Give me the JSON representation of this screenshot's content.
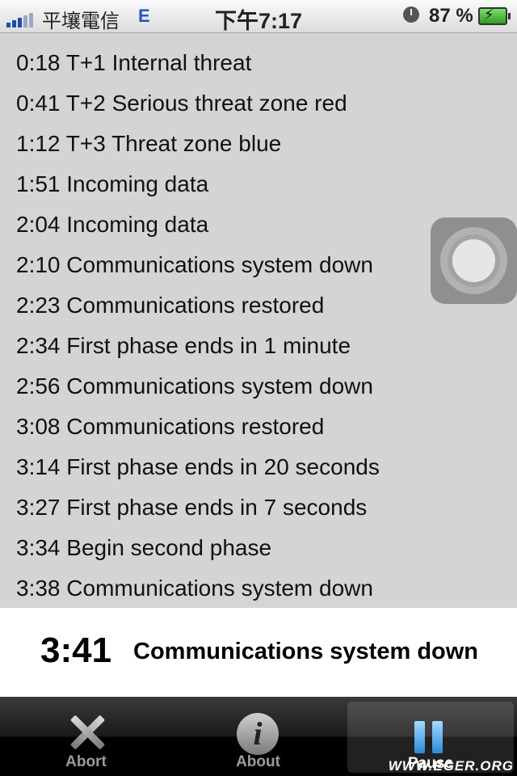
{
  "status_bar": {
    "carrier": "平壤電信",
    "network": "E",
    "time": "下午7:17",
    "battery": "87 %",
    "icons": [
      "signal-icon",
      "alarm-icon",
      "battery-charging-icon"
    ]
  },
  "events": [
    {
      "time": "0:18",
      "text": "T+1 Internal threat"
    },
    {
      "time": "0:41",
      "text": "T+2 Serious threat zone red"
    },
    {
      "time": "1:12",
      "text": "T+3 Threat zone blue"
    },
    {
      "time": "1:51",
      "text": "Incoming data"
    },
    {
      "time": "2:04",
      "text": "Incoming data"
    },
    {
      "time": "2:10",
      "text": "Communications system down"
    },
    {
      "time": "2:23",
      "text": "Communications restored"
    },
    {
      "time": "2:34",
      "text": "First phase ends in 1 minute"
    },
    {
      "time": "2:56",
      "text": "Communications system down"
    },
    {
      "time": "3:08",
      "text": "Communications restored"
    },
    {
      "time": "3:14",
      "text": "First phase ends in 20 seconds"
    },
    {
      "time": "3:27",
      "text": "First phase ends in 7 seconds"
    },
    {
      "time": "3:34",
      "text": "Begin second phase"
    },
    {
      "time": "3:38",
      "text": "Communications system down"
    }
  ],
  "current_event": {
    "time": "3:41",
    "text": "Communications system down"
  },
  "tabbar": {
    "abort_label": "Abort",
    "about_label": "About",
    "pause_label": "Pause",
    "selected": "Pause"
  },
  "watermark": "WWW.EGER.ORG"
}
